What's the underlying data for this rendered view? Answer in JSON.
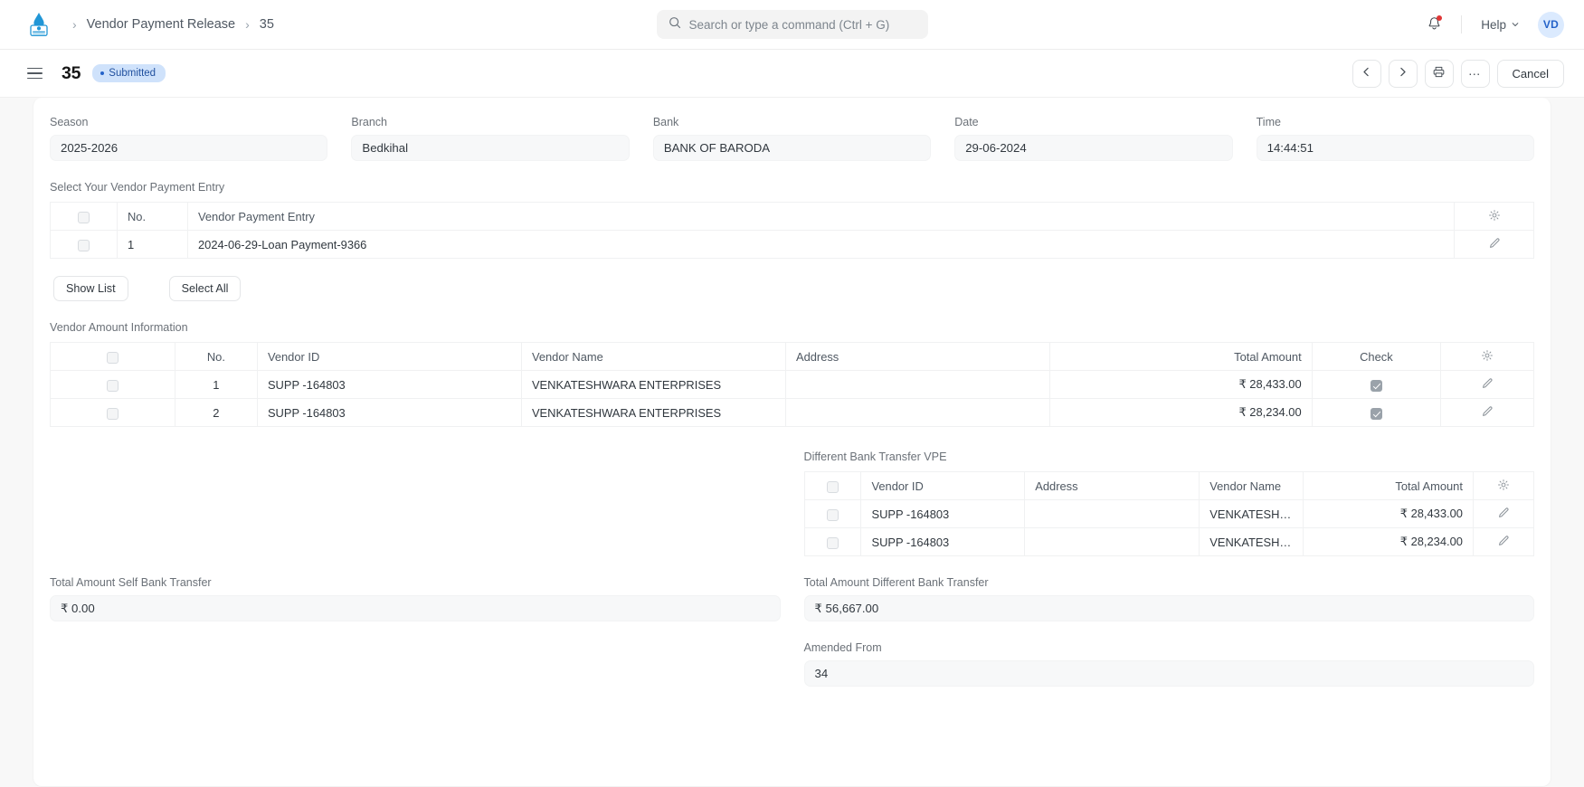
{
  "navbar": {
    "logo_icon": "app-logo-icon",
    "breadcrumb": {
      "separator": "›",
      "parent": "Vendor Payment Release",
      "current": "35"
    },
    "search": {
      "icon": "search-icon",
      "placeholder": "Search or type a command (Ctrl + G)",
      "value": ""
    },
    "notifications_icon": "bell-icon",
    "help_label": "Help",
    "help_caret_icon": "chevron-down-icon",
    "avatar_initials": "VD"
  },
  "page_head": {
    "menu_icon": "hamburger-menu-icon",
    "title": "35",
    "status": "Submitted",
    "actions": {
      "prev_icon": "chevron-left-icon",
      "next_icon": "chevron-right-icon",
      "print_icon": "printer-icon",
      "more_icon": "ellipsis-icon",
      "more_label": "…",
      "cancel_label": "Cancel"
    }
  },
  "form": {
    "fields": [
      {
        "label": "Season",
        "value": "2025-2026"
      },
      {
        "label": "Branch",
        "value": "Bedkihal"
      },
      {
        "label": "Bank",
        "value": "BANK OF BARODA"
      },
      {
        "label": "Date",
        "value": "29-06-2024"
      },
      {
        "label": "Time",
        "value": "14:44:51"
      }
    ],
    "vpe_section": {
      "label": "Select Your Vendor Payment Entry",
      "columns": [
        "",
        "No.",
        "Vendor Payment Entry",
        ""
      ],
      "settings_icon": "gear-icon",
      "rows": [
        {
          "no": "1",
          "entry": "2024-06-29-Loan Payment-9366",
          "edit_icon": "pencil-icon"
        }
      ],
      "buttons": {
        "show_list": "Show List",
        "select_all": "Select All"
      }
    },
    "vendor_amount_section": {
      "label": "Vendor Amount Information",
      "columns": [
        "",
        "No.",
        "Vendor ID",
        "Vendor Name",
        "Address",
        "Total Amount",
        "Check",
        ""
      ],
      "settings_icon": "gear-icon",
      "rows": [
        {
          "no": "1",
          "vendor_id": "SUPP -164803",
          "vendor_name": "VENKATESHWARA ENTERPRISES",
          "address": "",
          "total_amount": "₹ 28,433.00",
          "check": true,
          "edit_icon": "pencil-icon"
        },
        {
          "no": "2",
          "vendor_id": "SUPP -164803",
          "vendor_name": "VENKATESHWARA ENTERPRISES",
          "address": "",
          "total_amount": "₹ 28,234.00",
          "check": true,
          "edit_icon": "pencil-icon"
        }
      ]
    },
    "different_bank_section": {
      "label": "Different Bank Transfer VPE",
      "columns": [
        "",
        "Vendor ID",
        "Address",
        "Vendor Name",
        "Total Amount",
        ""
      ],
      "settings_icon": "gear-icon",
      "rows": [
        {
          "vendor_id": "SUPP -164803",
          "address": "",
          "vendor_name": "VENKATESHWAR...",
          "total_amount": "₹ 28,433.00",
          "edit_icon": "pencil-icon"
        },
        {
          "vendor_id": "SUPP -164803",
          "address": "",
          "vendor_name": "VENKATESHWAR...",
          "total_amount": "₹ 28,234.00",
          "edit_icon": "pencil-icon"
        }
      ]
    },
    "totals": [
      {
        "label": "Total Amount Self Bank Transfer",
        "value": "₹ 0.00"
      },
      {
        "label": "Total Amount Different Bank Transfer",
        "value": "₹ 56,667.00"
      }
    ],
    "amended_from": {
      "label": "Amended From",
      "value": "34"
    }
  },
  "colors": {
    "accent": "#2563c9",
    "status_bg": "#cfe2fb",
    "status_text": "#1f4f9e",
    "notification_dot": "#e03636",
    "avatar_bg": "#dbeafe",
    "page_bg": "#f8f8f8",
    "field_bg": "#f7f8f9"
  }
}
